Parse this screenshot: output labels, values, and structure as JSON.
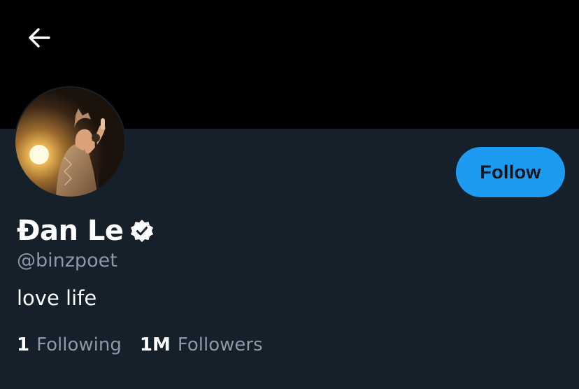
{
  "header": {
    "back_icon": "arrow-left-icon"
  },
  "profile": {
    "avatar_icon": "profile-photo",
    "name": "Đan Le",
    "verified_icon": "verified-badge-icon",
    "handle": "@binzpoet",
    "bio": "love life",
    "follow_label": "Follow",
    "following_count": "1",
    "following_label": "Following",
    "followers_count": "1M",
    "followers_label": "Followers"
  },
  "colors": {
    "background": "#15202b",
    "banner": "#000000",
    "accent": "#1d9bf0",
    "primary_text": "#ffffff",
    "secondary_text": "#8b98a5"
  }
}
